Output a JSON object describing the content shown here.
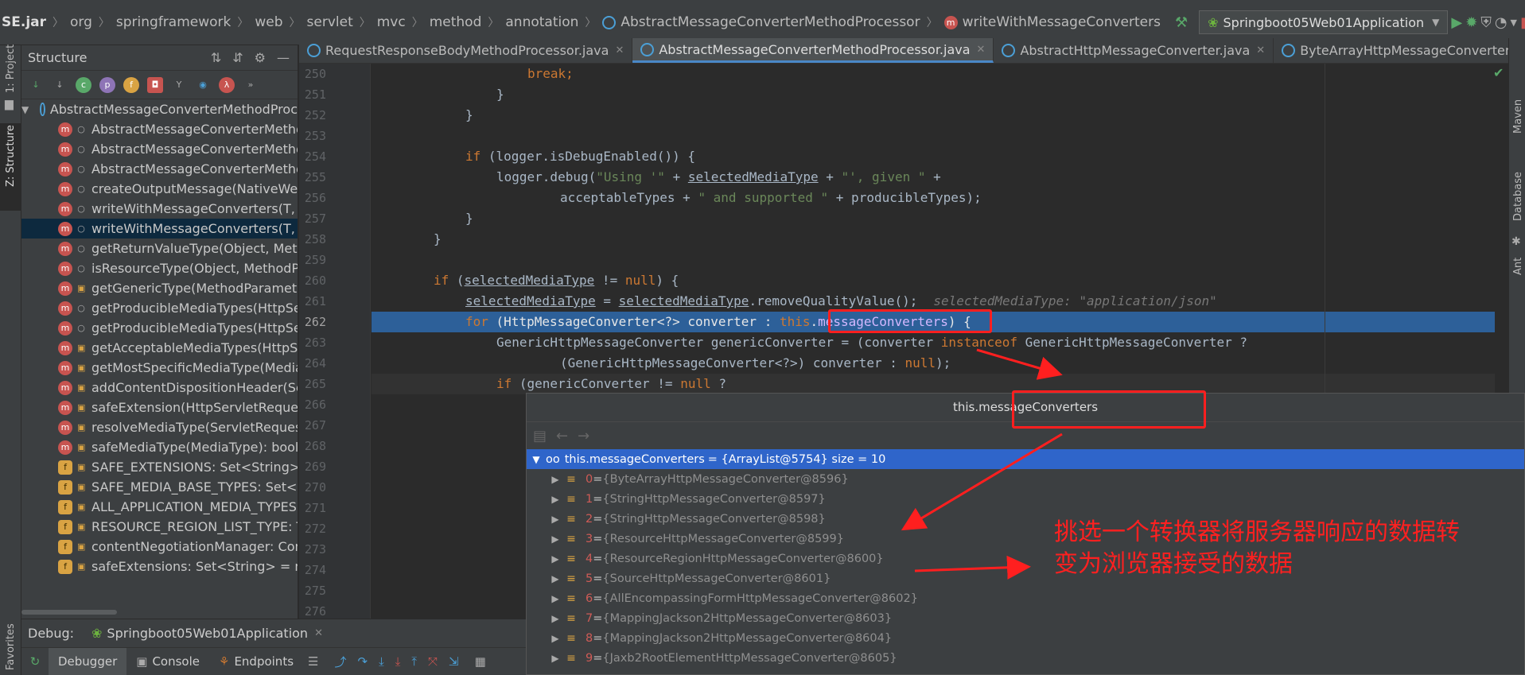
{
  "navbar": {
    "crumbs": [
      "SE.jar",
      "org",
      "springframework",
      "web",
      "servlet",
      "mvc",
      "method",
      "annotation",
      "AbstractMessageConverterMethodProcessor",
      "writeWithMessageConverters"
    ],
    "run_config": "Springboot05Web01Application"
  },
  "left_stripe": {
    "project": "1: Project",
    "structure": "Z: Structure",
    "favorites": "Favorites"
  },
  "right_stripe": {
    "maven": "Maven",
    "database": "Database",
    "ant": "Ant"
  },
  "structure": {
    "title": "Structure",
    "root": "AbstractMessageConverterMethodProc",
    "items": [
      {
        "kind": "m",
        "vis": "public",
        "label": "AbstractMessageConverterMethod"
      },
      {
        "kind": "m",
        "vis": "public",
        "label": "AbstractMessageConverterMethod"
      },
      {
        "kind": "m",
        "vis": "public",
        "label": "AbstractMessageConverterMethod"
      },
      {
        "kind": "m",
        "vis": "public",
        "label": "createOutputMessage(NativeWebR"
      },
      {
        "kind": "m",
        "vis": "public",
        "label": "writeWithMessageConverters(T, M"
      },
      {
        "kind": "m",
        "vis": "public",
        "label": "writeWithMessageConverters(T, M",
        "selected": true
      },
      {
        "kind": "m",
        "vis": "public",
        "label": "getReturnValueType(Object, Metho"
      },
      {
        "kind": "m",
        "vis": "public",
        "label": "isResourceType(Object, MethodPar"
      },
      {
        "kind": "m",
        "vis": "private",
        "label": "getGenericType(MethodParameter"
      },
      {
        "kind": "m",
        "vis": "public",
        "label": "getProducibleMediaTypes(HttpSer"
      },
      {
        "kind": "m",
        "vis": "public",
        "label": "getProducibleMediaTypes(HttpSer"
      },
      {
        "kind": "m",
        "vis": "private",
        "label": "getAcceptableMediaTypes(HttpSer"
      },
      {
        "kind": "m",
        "vis": "private",
        "label": "getMostSpecificMediaType(Media"
      },
      {
        "kind": "m",
        "vis": "private",
        "label": "addContentDispositionHeader(Serv"
      },
      {
        "kind": "m",
        "vis": "private",
        "label": "safeExtension(HttpServletRequest,"
      },
      {
        "kind": "m",
        "vis": "private",
        "label": "resolveMediaType(ServletRequest,"
      },
      {
        "kind": "m",
        "vis": "private",
        "label": "safeMediaType(MediaType): boolea"
      },
      {
        "kind": "f",
        "vis": "private",
        "label": "SAFE_EXTENSIONS: Set<String> = n"
      },
      {
        "kind": "f",
        "vis": "private",
        "label": "SAFE_MEDIA_BASE_TYPES: Set<Stri"
      },
      {
        "kind": "f",
        "vis": "private",
        "label": "ALL_APPLICATION_MEDIA_TYPES: L"
      },
      {
        "kind": "f",
        "vis": "private",
        "label": "RESOURCE_REGION_LIST_TYPE: Typ"
      },
      {
        "kind": "f",
        "vis": "private",
        "label": "contentNegotiationManager: Conte"
      },
      {
        "kind": "f",
        "vis": "private",
        "label": "safeExtensions: Set<String> = new"
      }
    ]
  },
  "tabs": [
    {
      "label": "RequestResponseBodyMethodProcessor.java",
      "active": false
    },
    {
      "label": "AbstractMessageConverterMethodProcessor.java",
      "active": true
    },
    {
      "label": "AbstractHttpMessageConverter.java",
      "active": false
    },
    {
      "label": "ByteArrayHttpMessageConverter.java",
      "active": false
    }
  ],
  "code": {
    "line_numbers": [
      "250",
      "251",
      "252",
      "253",
      "254",
      "255",
      "256",
      "257",
      "258",
      "259",
      "260",
      "261",
      "262",
      "263",
      "264",
      "265",
      "266",
      "267",
      "268",
      "269",
      "270",
      "271",
      "272",
      "273",
      "274",
      "275",
      "276"
    ],
    "current_line_index": 12,
    "l250": "break;",
    "l251": "}",
    "l252": "}",
    "l254_if": "if",
    "l254_rest": " (logger.isDebugEnabled()) {",
    "l255_a": "logger.debug(",
    "l255_s1": "\"Using '\"",
    "l255_b": " + ",
    "l255_v": "selectedMediaType",
    "l255_c": " + ",
    "l255_s2": "\"', given \"",
    "l255_d": " +",
    "l256_a": "acceptableTypes + ",
    "l256_s": "\" and supported \"",
    "l256_b": " + producibleTypes);",
    "l257": "}",
    "l258": "}",
    "l260_if": "if",
    "l260_a": " (",
    "l260_v": "selectedMediaType",
    "l260_b": " != ",
    "l260_null": "null",
    "l260_c": ") {",
    "l261_v1": "selectedMediaType",
    "l261_a": " = ",
    "l261_v2": "selectedMediaType",
    "l261_b": ".removeQualityValue();",
    "l261_hint": "selectedMediaType: \"application/json\"",
    "l262_for": "for",
    "l262_a": " (HttpMessageConverter<?> converter : ",
    "l262_this": "this",
    "l262_dot": ".",
    "l262_fld": "messageConverters",
    "l262_b": ") {",
    "l263_a": "GenericHttpMessageConverter genericConverter = (converter ",
    "l263_kw": "instanceof",
    "l263_b": " GenericHttpMessageConverter ?",
    "l264_a": "(GenericHttpMessageConverter<?>) converter : ",
    "l264_null": "null",
    "l264_b": ");",
    "l265_if": "if",
    "l265_a": " (genericConverter != ",
    "l265_null": "null",
    "l265_b": " ?"
  },
  "popup": {
    "title": "this.messageConverters",
    "root": {
      "name": "this.messageConverters",
      "value": "= {ArrayList@5754}  size = 10"
    },
    "items": [
      {
        "idx": "0",
        "value": "{ByteArrayHttpMessageConverter@8596}"
      },
      {
        "idx": "1",
        "value": "{StringHttpMessageConverter@8597}"
      },
      {
        "idx": "2",
        "value": "{StringHttpMessageConverter@8598}"
      },
      {
        "idx": "3",
        "value": "{ResourceHttpMessageConverter@8599}"
      },
      {
        "idx": "4",
        "value": "{ResourceRegionHttpMessageConverter@8600}"
      },
      {
        "idx": "5",
        "value": "{SourceHttpMessageConverter@8601}"
      },
      {
        "idx": "6",
        "value": "{AllEncompassingFormHttpMessageConverter@8602}"
      },
      {
        "idx": "7",
        "value": "{MappingJackson2HttpMessageConverter@8603}"
      },
      {
        "idx": "8",
        "value": "{MappingJackson2HttpMessageConverter@8604}"
      },
      {
        "idx": "9",
        "value": "{Jaxb2RootElementHttpMessageConverter@8605}"
      }
    ]
  },
  "debug": {
    "label": "Debug:",
    "session": "Springboot05Web01Application",
    "tabs": [
      "Debugger",
      "Console",
      "Endpoints"
    ]
  },
  "annotation": {
    "line1": "挑选一个转换器将服务器响应的数据转",
    "line2": "变为浏览器接受的数据"
  },
  "colors": {
    "keyword": "#cc7832",
    "string": "#6a8759",
    "field": "#9876aa",
    "annotation_red": "#ff1f1f",
    "selection": "#2d6099"
  }
}
